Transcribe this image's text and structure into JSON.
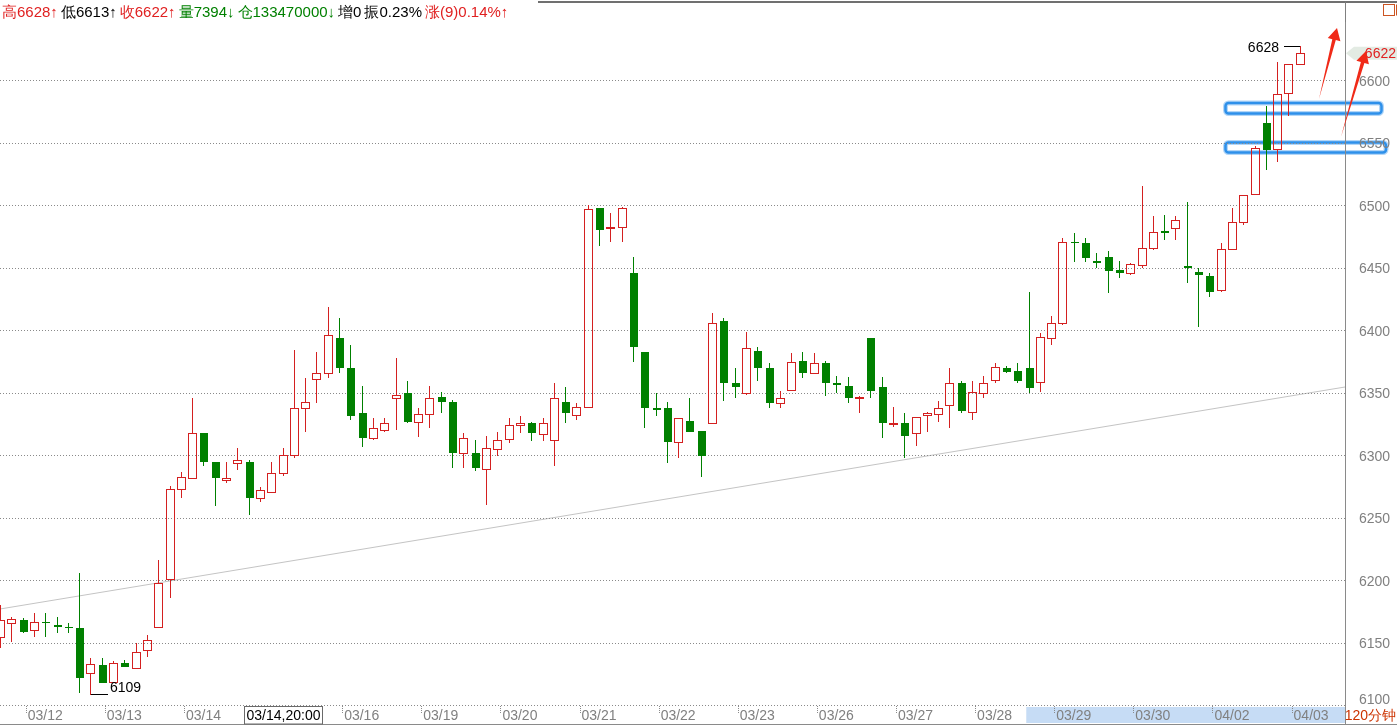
{
  "info_bar": {
    "items": [
      {
        "text": "高6628↑",
        "color": "#e02020"
      },
      {
        "text": "低6613↑",
        "color": "#000000"
      },
      {
        "text": "收6622↑",
        "color": "#e02020"
      },
      {
        "text": "量7394↓",
        "color": "#008000"
      },
      {
        "text": "仓133470000↓",
        "color": "#008000"
      },
      {
        "text": "增0",
        "color": "#000000"
      },
      {
        "text": "振0.23%",
        "color": "#000000"
      },
      {
        "text": "涨(9)0.14%↑",
        "color": "#e02020"
      }
    ]
  },
  "chart": {
    "chart_data": {
      "type": "candlestick",
      "categories": [
        null,
        null,
        null,
        null,
        "03/12",
        null,
        null,
        null,
        null,
        null,
        null,
        "03/13",
        null,
        null,
        null,
        null,
        null,
        null,
        "03/14",
        null,
        null,
        null,
        null,
        null,
        null,
        null,
        null,
        null,
        null,
        null,
        null,
        null,
        "03/16",
        null,
        null,
        null,
        null,
        null,
        null,
        "03/19",
        null,
        null,
        null,
        null,
        null,
        null,
        "03/20",
        null,
        null,
        null,
        null,
        null,
        null,
        "03/21",
        null,
        null,
        null,
        null,
        null,
        null,
        "03/22",
        null,
        null,
        null,
        null,
        null,
        null,
        "03/23",
        null,
        null,
        null,
        null,
        null,
        null,
        "03/26",
        null,
        null,
        null,
        null,
        null,
        null,
        "03/27",
        null,
        null,
        null,
        null,
        null,
        null,
        "03/28",
        null,
        null,
        null,
        null,
        null,
        null,
        "03/29",
        null,
        null,
        null,
        null,
        null,
        null,
        "03/30",
        null,
        null,
        null,
        null,
        null,
        null,
        "04/02",
        null,
        null,
        null,
        null,
        null,
        null,
        "04/03"
      ],
      "ohlc": [
        [
          6155,
          6181,
          6146,
          6168
        ],
        [
          6166,
          6171,
          6151,
          6169
        ],
        [
          6169,
          6170,
          6158,
          6159
        ],
        [
          6160,
          6174,
          6155,
          6167
        ],
        [
          6167,
          6174,
          6155,
          6166
        ],
        [
          6165,
          6171,
          6158,
          6163
        ],
        [
          6163,
          6166,
          6158,
          6162
        ],
        [
          6162,
          6206,
          6110,
          6122
        ],
        [
          6126,
          6138,
          6109,
          6133
        ],
        [
          6133,
          6138,
          6118,
          6118
        ],
        [
          6119,
          6136,
          6119,
          6134
        ],
        [
          6134,
          6137,
          6131,
          6131
        ],
        [
          6130,
          6150,
          6130,
          6143
        ],
        [
          6144,
          6157,
          6139,
          6152
        ],
        [
          6163,
          6217,
          6162,
          6198
        ],
        [
          6201,
          6276,
          6186,
          6273
        ],
        [
          6273,
          6287,
          6266,
          6283
        ],
        [
          6282,
          6346,
          6282,
          6318
        ],
        [
          6318,
          6318,
          6292,
          6295
        ],
        [
          6295,
          6295,
          6260,
          6282
        ],
        [
          6280,
          6295,
          6278,
          6282
        ],
        [
          6294,
          6306,
          6289,
          6296
        ],
        [
          6295,
          6297,
          6253,
          6266
        ],
        [
          6266,
          6275,
          6263,
          6272
        ],
        [
          6271,
          6295,
          6270,
          6286
        ],
        [
          6286,
          6306,
          6284,
          6300
        ],
        [
          6300,
          6385,
          6298,
          6338
        ],
        [
          6338,
          6362,
          6319,
          6343
        ],
        [
          6361,
          6383,
          6342,
          6366
        ],
        [
          6366,
          6419,
          6362,
          6396
        ],
        [
          6394,
          6410,
          6366,
          6370
        ],
        [
          6370,
          6389,
          6329,
          6332
        ],
        [
          6334,
          6356,
          6307,
          6314
        ],
        [
          6314,
          6330,
          6313,
          6322
        ],
        [
          6320,
          6330,
          6319,
          6326
        ],
        [
          6346,
          6378,
          6321,
          6348
        ],
        [
          6350,
          6360,
          6326,
          6327
        ],
        [
          6327,
          6338,
          6315,
          6333
        ],
        [
          6333,
          6356,
          6322,
          6346
        ],
        [
          6347,
          6351,
          6334,
          6343
        ],
        [
          6343,
          6345,
          6290,
          6302
        ],
        [
          6302,
          6318,
          6290,
          6314
        ],
        [
          6302,
          6313,
          6288,
          6290
        ],
        [
          6289,
          6316,
          6261,
          6306
        ],
        [
          6305,
          6319,
          6300,
          6312
        ],
        [
          6313,
          6330,
          6310,
          6324
        ],
        [
          6324,
          6332,
          6318,
          6326
        ],
        [
          6326,
          6327,
          6312,
          6318
        ],
        [
          6317,
          6330,
          6312,
          6326
        ],
        [
          6312,
          6358,
          6292,
          6346
        ],
        [
          6343,
          6355,
          6326,
          6334
        ],
        [
          6332,
          6342,
          6329,
          6339
        ],
        [
          6339,
          6501,
          6339,
          6497
        ],
        [
          6498,
          6498,
          6468,
          6481
        ],
        [
          6482,
          6494,
          6471,
          6483
        ],
        [
          6483,
          6499,
          6471,
          6498
        ],
        [
          6446,
          6459,
          6375,
          6387
        ],
        [
          6383,
          6383,
          6322,
          6338
        ],
        [
          6338,
          6350,
          6332,
          6337
        ],
        [
          6338,
          6343,
          6294,
          6311
        ],
        [
          6311,
          6330,
          6298,
          6330
        ],
        [
          6328,
          6346,
          6319,
          6319
        ],
        [
          6320,
          6320,
          6283,
          6300
        ],
        [
          6326,
          6414,
          6326,
          6406
        ],
        [
          6408,
          6410,
          6344,
          6358
        ],
        [
          6358,
          6370,
          6346,
          6355
        ],
        [
          6350,
          6399,
          6349,
          6386
        ],
        [
          6384,
          6387,
          6360,
          6370
        ],
        [
          6370,
          6374,
          6338,
          6342
        ],
        [
          6342,
          6352,
          6338,
          6346
        ],
        [
          6352,
          6382,
          6352,
          6375
        ],
        [
          6376,
          6383,
          6362,
          6366
        ],
        [
          6366,
          6382,
          6366,
          6374
        ],
        [
          6374,
          6376,
          6348,
          6358
        ],
        [
          6358,
          6364,
          6350,
          6357
        ],
        [
          6356,
          6363,
          6342,
          6346
        ],
        [
          6346,
          6348,
          6334,
          6347
        ],
        [
          6394,
          6394,
          6346,
          6352
        ],
        [
          6355,
          6363,
          6314,
          6326
        ],
        [
          6325,
          6339,
          6323,
          6326
        ],
        [
          6326,
          6334,
          6298,
          6316
        ],
        [
          6318,
          6331,
          6308,
          6331
        ],
        [
          6332,
          6335,
          6319,
          6334
        ],
        [
          6333,
          6344,
          6327,
          6338
        ],
        [
          6340,
          6370,
          6322,
          6358
        ],
        [
          6358,
          6360,
          6334,
          6336
        ],
        [
          6335,
          6360,
          6329,
          6351
        ],
        [
          6350,
          6364,
          6346,
          6358
        ],
        [
          6360,
          6374,
          6358,
          6371
        ],
        [
          6370,
          6372,
          6366,
          6367
        ],
        [
          6368,
          6374,
          6358,
          6360
        ],
        [
          6370,
          6431,
          6350,
          6354
        ],
        [
          6359,
          6398,
          6351,
          6395
        ],
        [
          6394,
          6412,
          6389,
          6406
        ],
        [
          6406,
          6474,
          6405,
          6471
        ],
        [
          6471,
          6478,
          6455,
          6470
        ],
        [
          6470,
          6474,
          6455,
          6458
        ],
        [
          6456,
          6462,
          6450,
          6454
        ],
        [
          6459,
          6464,
          6430,
          6448
        ],
        [
          6449,
          6456,
          6442,
          6446
        ],
        [
          6446,
          6454,
          6445,
          6453
        ],
        [
          6452,
          6516,
          6450,
          6466
        ],
        [
          6466,
          6492,
          6465,
          6479
        ],
        [
          6480,
          6493,
          6473,
          6478
        ],
        [
          6482,
          6492,
          6473,
          6488
        ],
        [
          6452,
          6503,
          6438,
          6450
        ],
        [
          6447,
          6450,
          6403,
          6445
        ],
        [
          6444,
          6446,
          6427,
          6431
        ],
        [
          6432,
          6470,
          6431,
          6465
        ],
        [
          6465,
          6498,
          6465,
          6487
        ],
        [
          6487,
          6508,
          6485,
          6508
        ],
        [
          6509,
          6548,
          6509,
          6546
        ],
        [
          6566,
          6580,
          6529,
          6545
        ],
        [
          6545,
          6615,
          6535,
          6589
        ],
        [
          6590,
          6613,
          6572,
          6613
        ],
        [
          6613,
          6628,
          6613,
          6622
        ],
        null
      ],
      "ylim": [
        6100,
        6647
      ],
      "yticks": [
        6600,
        6550,
        6500,
        6450,
        6400,
        6350,
        6300,
        6250,
        6200,
        6150,
        6100
      ],
      "grid": true
    },
    "last_price_tag": "6622",
    "high_label": "6628",
    "low_label": "6109",
    "cursor_time_label": "03/14,20:00",
    "period_label": "120分钟"
  }
}
